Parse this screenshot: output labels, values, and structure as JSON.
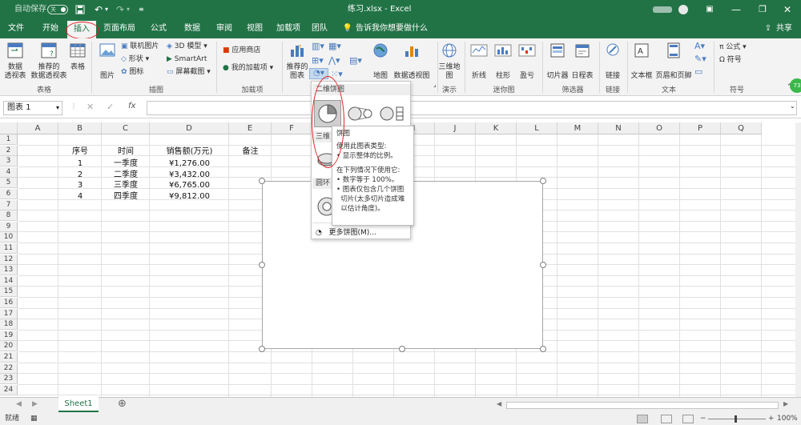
{
  "titlebar": {
    "autosave": "自动保存",
    "autosave_state": "关",
    "title": "练习.xlsx  -  Excel"
  },
  "tabs": [
    {
      "label": "文件"
    },
    {
      "label": "开始"
    },
    {
      "label": "插入"
    },
    {
      "label": "页面布局"
    },
    {
      "label": "公式"
    },
    {
      "label": "数据"
    },
    {
      "label": "审阅"
    },
    {
      "label": "视图"
    },
    {
      "label": "加载项"
    },
    {
      "label": "团队"
    }
  ],
  "tell_me": "告诉我你想要做什么",
  "share": "共享",
  "ribbon": {
    "pivot": "数据\n透视表",
    "rec_pivot": "推荐的\n数据透视表",
    "table": "表格",
    "group_table": "表格",
    "picture": "图片",
    "online_pic": "联机图片",
    "shapes": "形状",
    "icons": "图标",
    "model3d": "3D 模型",
    "smartart": "SmartArt",
    "screenshot": "屏幕截图",
    "group_illus": "插图",
    "store": "应用商店",
    "myaddins": "我的加载项",
    "group_addins": "加载项",
    "rec_charts": "推荐的\n图表",
    "map": "地图",
    "pivotchart": "数据透视图",
    "map3d": "三维地\n图",
    "group_tour": "演示",
    "line": "折线",
    "column": "柱形",
    "winloss": "盈亏",
    "group_spark": "迷你图",
    "slicer": "切片器",
    "timeline": "日程表",
    "group_filter": "筛选器",
    "link": "链接",
    "group_link": "链接",
    "textbox": "文本框",
    "headerfooter": "页眉和页脚",
    "group_text": "文本",
    "formula": "公式",
    "symbol": "符号",
    "group_symbol": "符号"
  },
  "namebox": "图表 1",
  "columns": [
    "A",
    "B",
    "C",
    "D",
    "E",
    "F",
    "G",
    "H",
    "I",
    "J",
    "K",
    "L",
    "M",
    "N",
    "O",
    "P",
    "Q"
  ],
  "rows": [
    "1",
    "2",
    "3",
    "4",
    "5",
    "6",
    "7",
    "8",
    "9",
    "10",
    "11",
    "12",
    "13",
    "14",
    "15",
    "16",
    "17",
    "18",
    "19",
    "20",
    "21",
    "22",
    "23",
    "24"
  ],
  "sheet": {
    "headers": {
      "seq": "序号",
      "time": "时间",
      "sales": "销售额(万元)",
      "note": "备注"
    },
    "data": [
      {
        "seq": "1",
        "time": "一季度",
        "sales": "¥1,276.00"
      },
      {
        "seq": "2",
        "time": "二季度",
        "sales": "¥3,432.00"
      },
      {
        "seq": "3",
        "time": "三季度",
        "sales": "¥6,765.00"
      },
      {
        "seq": "4",
        "time": "四季度",
        "sales": "¥9,812.00"
      }
    ]
  },
  "dropdown": {
    "section_2d": "二维饼图",
    "section_3d": "三维",
    "section_donut": "圆环",
    "more": "更多饼图(M)..."
  },
  "tooltip": {
    "title": "饼图",
    "lines": [
      "使用此图表类型:",
      "• 显示整体的比例。",
      "",
      "在下列情况下使用它:",
      "• 数字等于 100%。",
      "• 图表仅包含几个饼图",
      "  切片(太多切片造成难",
      "  以估计角度)。"
    ]
  },
  "sheet_tab": "Sheet1",
  "status": {
    "ready": "就绪",
    "zoom": "100%"
  },
  "colors": {
    "excel_green": "#217346",
    "annotation_red": "#e02020"
  }
}
